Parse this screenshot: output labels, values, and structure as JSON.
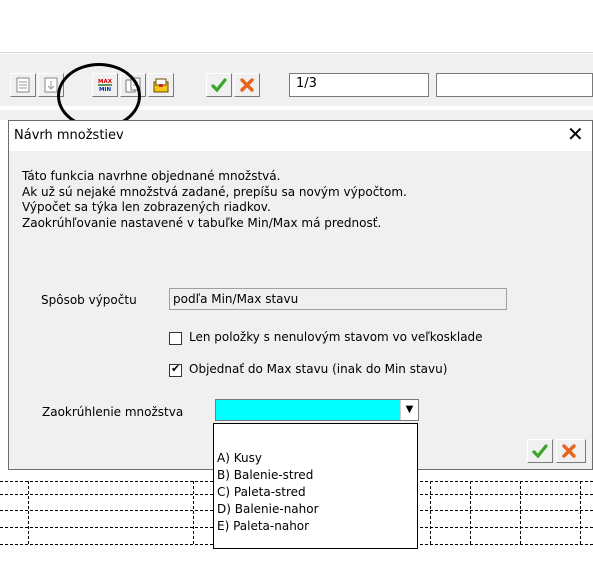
{
  "toolbar": {
    "record_counter": "1/3",
    "buttons": [
      "open-record-icon",
      "save-record-icon",
      "max-min-icon",
      "copy-icon",
      "yellow-folder-icon",
      "confirm-check-icon",
      "cancel-x-icon"
    ],
    "max_icon_top": "MAX",
    "max_icon_bottom": "MIN"
  },
  "dialog": {
    "title": "Návrh množstiev",
    "close_glyph": "✕",
    "description": [
      "Táto funkcia navrhne objednané množstvá.",
      "Ak už sú nejaké množstvá zadané, prepíšu sa novým výpočtom.",
      "Výpočet sa týka len zobrazených riadkov.",
      "Zaokrúhľovanie nastavené v tabuľke Min/Max má prednosť."
    ],
    "method_label": "Spôsob výpočtu",
    "method_value": "podľa Min/Max stavu",
    "checkbox1_label": "Len položky s nenulovým stavom vo veľkosklade",
    "checkbox1_checked": false,
    "checkbox2_label": "Objednať do Max stavu (inak do Min stavu)",
    "checkbox2_checked": true,
    "rounding_label": "Zaokrúhlenie množstva",
    "rounding_value": "",
    "rounding_options": [
      "A) Kusy",
      "B) Balenie-stred",
      "C) Paleta-stred",
      "D) Balenie-nahor",
      "E) Paleta-nahor"
    ]
  },
  "colors": {
    "highlight": "#00ffff",
    "check_green": "#3aa52a",
    "cancel_orange": "#e8641e"
  }
}
